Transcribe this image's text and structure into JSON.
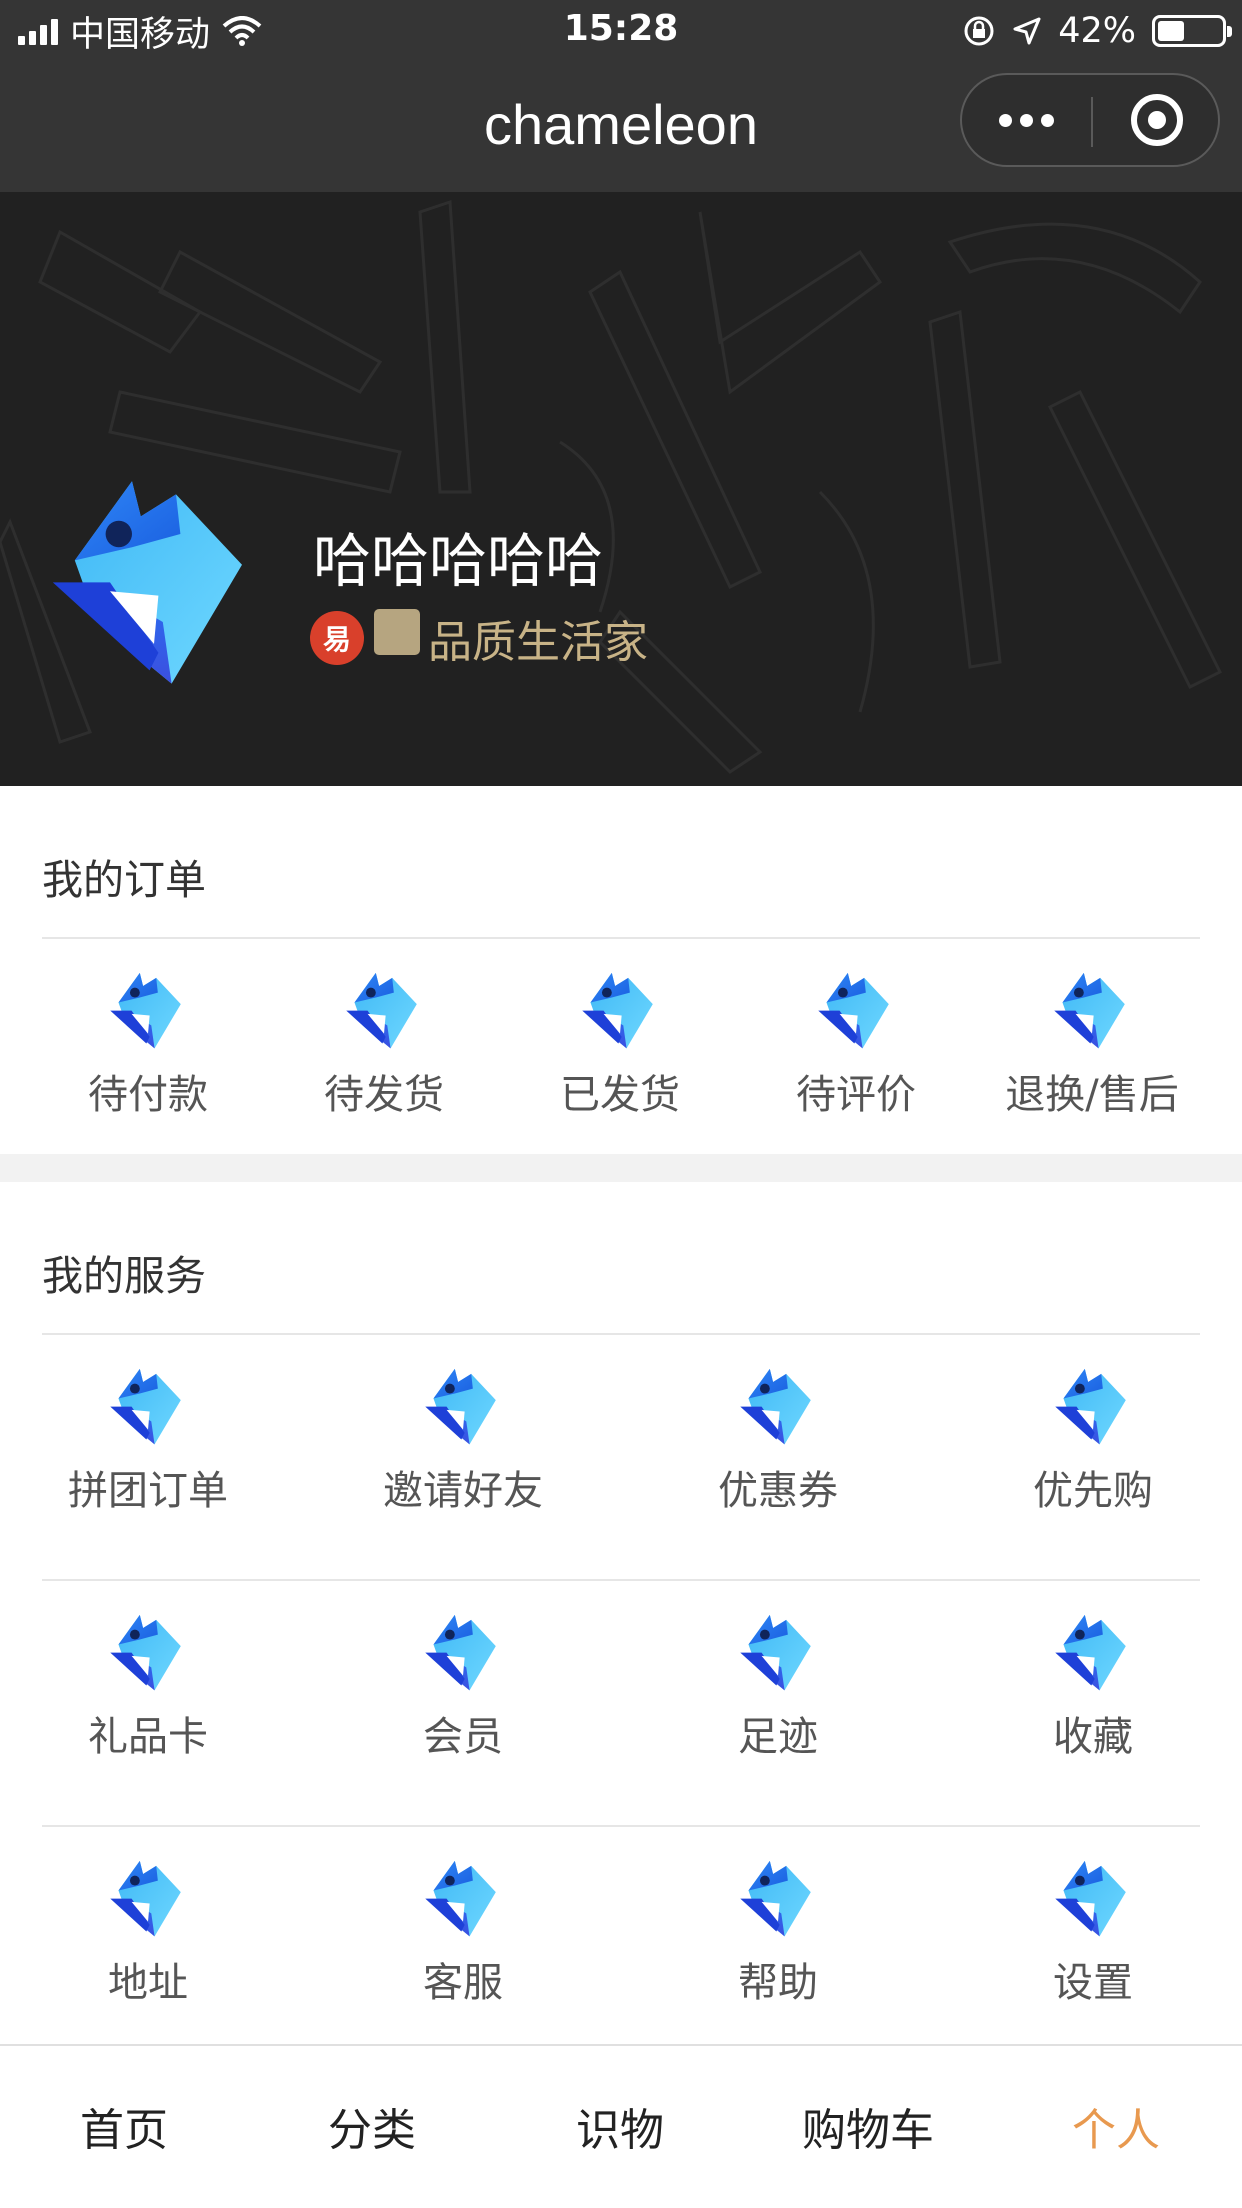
{
  "status_bar": {
    "carrier": "中国移动",
    "time": "15:28",
    "battery": "42%",
    "battery_fraction": 0.42
  },
  "nav": {
    "title": "chameleon"
  },
  "profile": {
    "name": "哈哈哈哈哈",
    "badge_glyph": "易",
    "level": "品质生活家"
  },
  "orders": {
    "title": "我的订单",
    "items": [
      {
        "label": "待付款",
        "icon": "logo-icon"
      },
      {
        "label": "待发货",
        "icon": "logo-icon"
      },
      {
        "label": "已发货",
        "icon": "logo-icon"
      },
      {
        "label": "待评价",
        "icon": "logo-icon"
      },
      {
        "label": "退换/售后",
        "icon": "logo-icon"
      }
    ]
  },
  "services": {
    "title": "我的服务",
    "items": [
      {
        "label": "拼团订单",
        "icon": "logo-icon"
      },
      {
        "label": "邀请好友",
        "icon": "logo-icon"
      },
      {
        "label": "优惠券",
        "icon": "logo-icon"
      },
      {
        "label": "优先购",
        "icon": "logo-icon"
      },
      {
        "label": "礼品卡",
        "icon": "logo-icon"
      },
      {
        "label": "会员",
        "icon": "logo-icon"
      },
      {
        "label": "足迹",
        "icon": "logo-icon"
      },
      {
        "label": "收藏",
        "icon": "logo-icon"
      },
      {
        "label": "地址",
        "icon": "logo-icon"
      },
      {
        "label": "客服",
        "icon": "logo-icon"
      },
      {
        "label": "帮助",
        "icon": "logo-icon"
      },
      {
        "label": "设置",
        "icon": "logo-icon"
      }
    ]
  },
  "tab_bar": {
    "tabs": [
      {
        "label": "首页",
        "active": false
      },
      {
        "label": "分类",
        "active": false
      },
      {
        "label": "识物",
        "active": false
      },
      {
        "label": "购物车",
        "active": false
      },
      {
        "label": "个人",
        "active": true
      }
    ]
  },
  "colors": {
    "accent": "#e8994f",
    "header_bg": "#353535",
    "profile_bg": "#212121",
    "level_text": "#c8b387"
  }
}
